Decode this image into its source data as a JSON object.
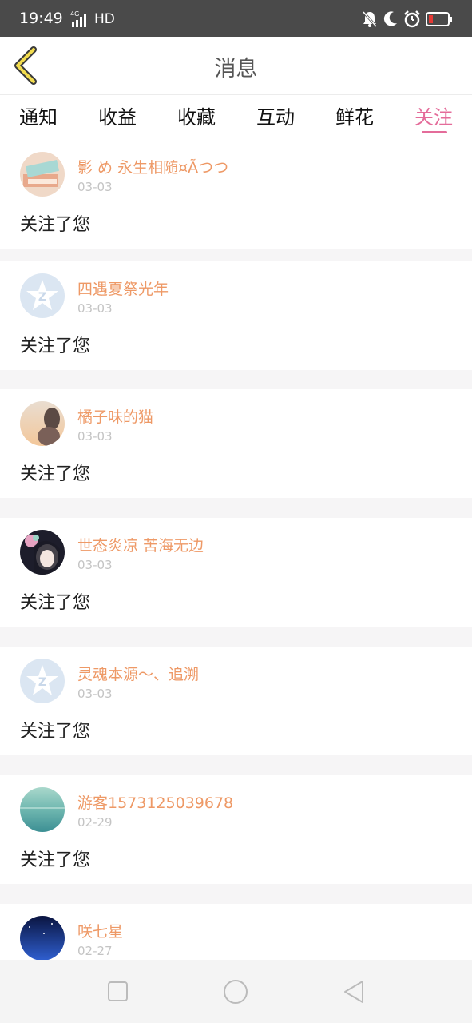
{
  "status_bar": {
    "time": "19:49",
    "network": "HD",
    "icons": [
      "signal-4g-icon",
      "mute-bell-icon",
      "moon-icon",
      "alarm-icon",
      "battery-low-icon"
    ]
  },
  "header": {
    "title": "消息",
    "back_icon": "chevron-left-icon"
  },
  "tabs": [
    {
      "label": "通知"
    },
    {
      "label": "收益"
    },
    {
      "label": "收藏"
    },
    {
      "label": "互动"
    },
    {
      "label": "鲜花"
    },
    {
      "label": "关注"
    }
  ],
  "active_tab": "关注",
  "notifications": [
    {
      "name": "影 め 永生相随¤Ãつつ",
      "date": "03-03",
      "action": "关注了您",
      "avatar": "photo-books-avatar"
    },
    {
      "name": "四遇夏祭光年",
      "date": "03-03",
      "action": "关注了您",
      "avatar": "default-star-avatar"
    },
    {
      "name": "橘子味的猫",
      "date": "03-03",
      "action": "关注了您",
      "avatar": "photo-girl-avatar"
    },
    {
      "name": "世态炎凉 苦海无边",
      "date": "03-03",
      "action": "关注了您",
      "avatar": "anime-girl-avatar"
    },
    {
      "name": "灵魂本源〜、追溯",
      "date": "03-03",
      "action": "关注了您",
      "avatar": "default-star-avatar"
    },
    {
      "name": "游客1573125039678",
      "date": "02-29",
      "action": "关注了您",
      "avatar": "sea-avatar"
    },
    {
      "name": "咲七星",
      "date": "02-27",
      "action": "",
      "avatar": "night-sky-avatar"
    }
  ],
  "nav_bar": {
    "icons": [
      "recents-square-icon",
      "home-circle-icon",
      "back-triangle-icon"
    ]
  },
  "colors": {
    "accent_pink": "#e46c9a",
    "username_orange": "#ee9966",
    "back_arrow_yellow": "#f2dc4e"
  }
}
